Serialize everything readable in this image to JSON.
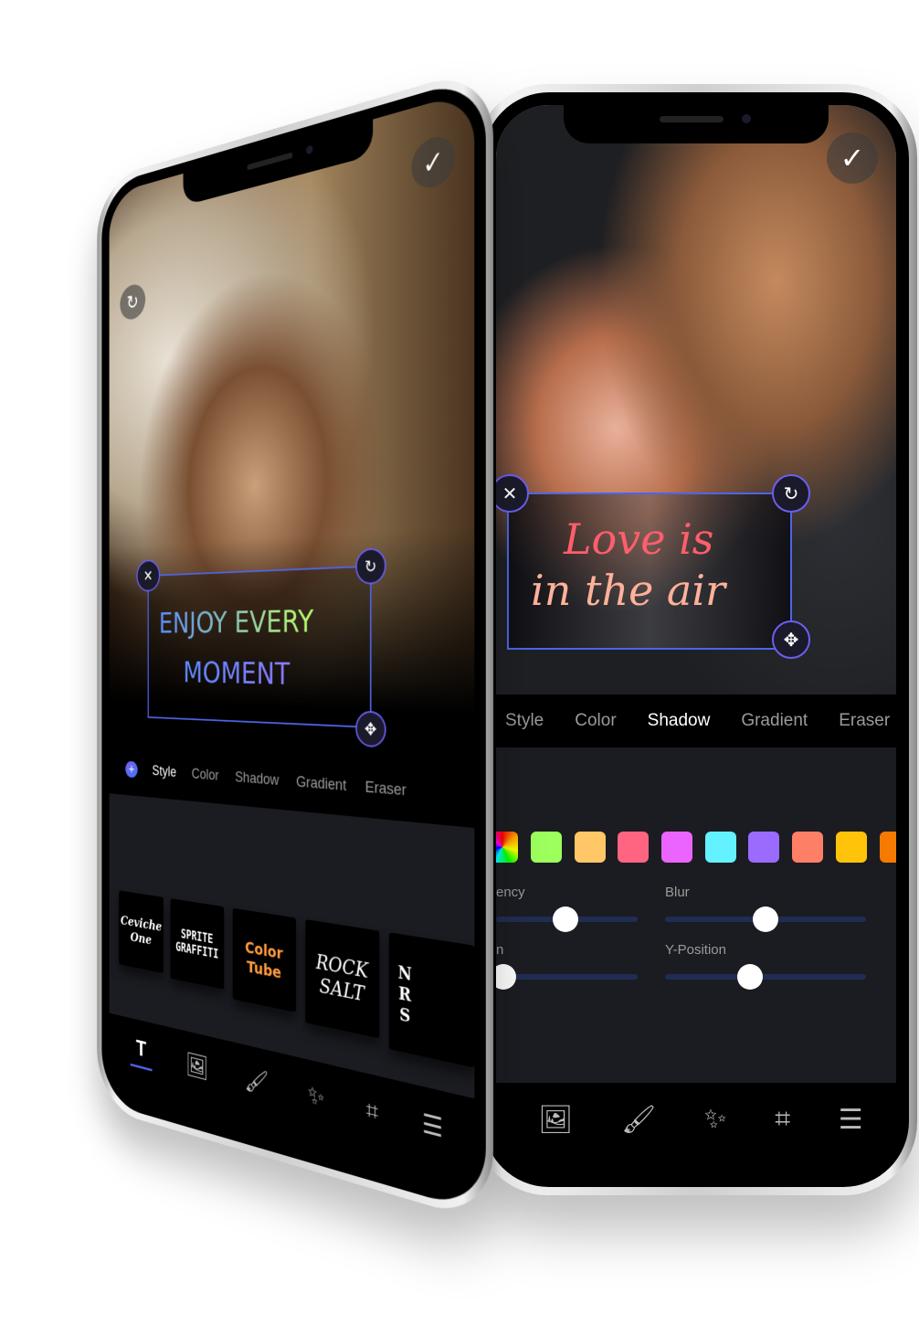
{
  "right_phone": {
    "confirm_icon": "checkmark-icon",
    "overlay_text": [
      "Love is",
      "in the air"
    ],
    "overlay_colors": [
      "#ff5e6c",
      "#ffd1a0"
    ],
    "tabs": [
      {
        "label": "Style",
        "active": false
      },
      {
        "label": "Color",
        "active": false
      },
      {
        "label": "Shadow",
        "active": true
      },
      {
        "label": "Gradient",
        "active": false
      },
      {
        "label": "Eraser",
        "active": false
      }
    ],
    "swatches": [
      "rainbow",
      "#9cff5c",
      "#ffc766",
      "#ff6481",
      "#ec64ff",
      "#63f2ff",
      "#9b6bff",
      "#ff7f66",
      "#ffc40a",
      "#f57a00"
    ],
    "sliders": [
      {
        "label": "ency",
        "value": 0.5
      },
      {
        "label": "Blur",
        "value": 0.5
      },
      {
        "label": "n",
        "value": 0.0
      },
      {
        "label": "Y-Position",
        "value": 0.42
      }
    ],
    "toolbar": [
      "image-icon",
      "brush-icon",
      "magic-wand-icon",
      "crop-icon",
      "sliders-icon"
    ]
  },
  "left_phone": {
    "confirm_icon": "checkmark-icon",
    "rotate_icon": "refresh-icon",
    "overlay_text": [
      "ENJOY EVERY",
      "MOMENT"
    ],
    "plus_label": "+",
    "tabs": [
      {
        "label": "Style",
        "active": true
      },
      {
        "label": "Color",
        "active": false
      },
      {
        "label": "Shadow",
        "active": false
      },
      {
        "label": "Gradient",
        "active": false
      },
      {
        "label": "Eraser",
        "active": false
      }
    ],
    "fonts": [
      {
        "label": "Ceviche\nOne"
      },
      {
        "label": "SPRITE\nGRAFFITI"
      },
      {
        "label": "Color\nTube"
      },
      {
        "label": "ROCK\nSALT"
      },
      {
        "label": "N\nR\nS"
      }
    ],
    "toolbar": [
      "text-icon",
      "image-icon",
      "brush-icon",
      "magic-wand-icon",
      "crop-icon",
      "sliders-icon"
    ],
    "toolbar_text_glyph": "T"
  }
}
